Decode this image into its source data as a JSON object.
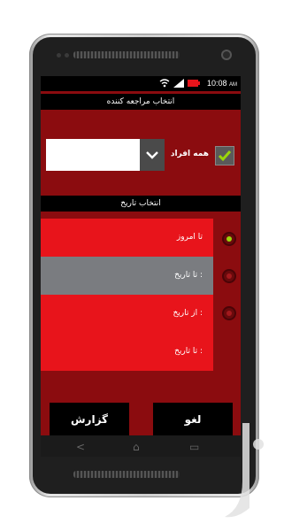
{
  "statusbar": {
    "time": "10:08",
    "ampm": "AM"
  },
  "sections": {
    "referrer_title": "انتخاب مراجعه کننده",
    "date_title": "انتخاب تاریخ"
  },
  "referrer": {
    "all_people_label": "همه افراد",
    "all_people_checked": true,
    "combo_value": ""
  },
  "date_options": [
    {
      "label": "تا امروز",
      "selected": true
    },
    {
      "label": "تا تاریخ :",
      "selected": false
    },
    {
      "label": "از تاریخ :",
      "selected": false
    },
    {
      "label": "تا تاریخ :",
      "selected": false
    }
  ],
  "buttons": {
    "report": "گزارش",
    "cancel": "لغو"
  },
  "colors": {
    "app_bg": "#8b0c0f",
    "row_red": "#e8141b",
    "row_gray": "#7a7c80",
    "radio_on": "#9bd60a",
    "check": "#9bd60a"
  },
  "icons": {
    "check": "check-icon",
    "dropdown": "chevron-down-icon",
    "wifi": "wifi-icon",
    "signal": "signal-icon",
    "battery": "battery-icon",
    "back": "back-icon",
    "home": "home-icon",
    "recents": "recents-icon"
  }
}
